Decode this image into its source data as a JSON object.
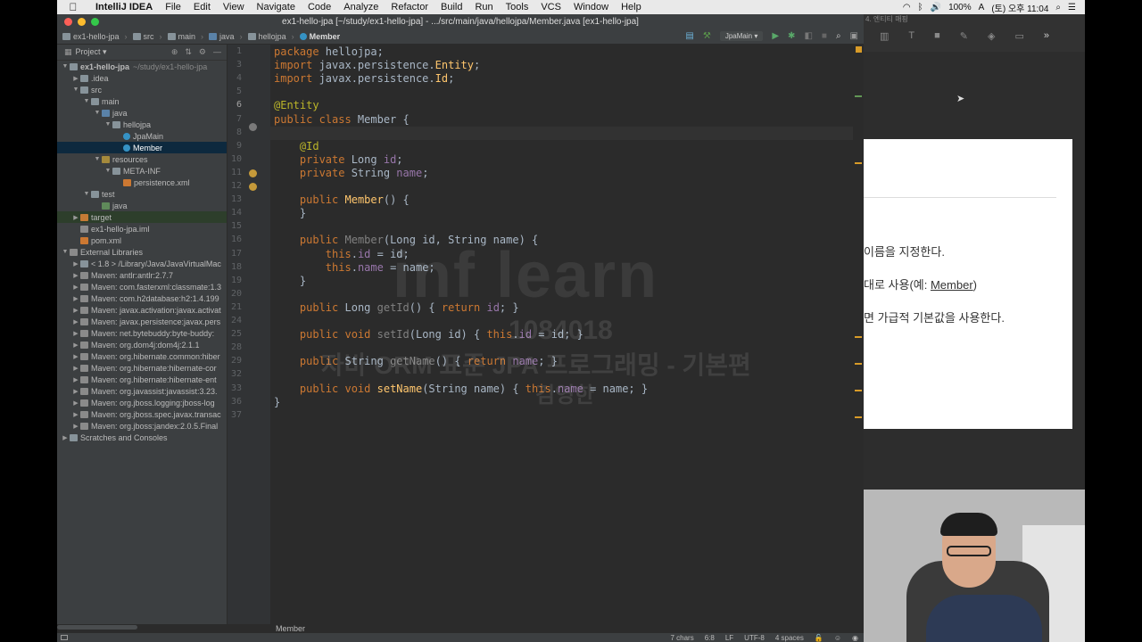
{
  "menubar": {
    "app_name": "IntelliJ IDEA",
    "items": [
      "File",
      "Edit",
      "View",
      "Navigate",
      "Code",
      "Analyze",
      "Refactor",
      "Build",
      "Run",
      "Tools",
      "VCS",
      "Window",
      "Help"
    ],
    "battery": "100%",
    "clock": "(토) 오후 11:04"
  },
  "window": {
    "title": "ex1-hello-jpa [~/study/ex1-hello-jpa] - .../src/main/java/hellojpa/Member.java [ex1-hello-jpa]"
  },
  "breadcrumbs": [
    "ex1-hello-jpa",
    "src",
    "main",
    "java",
    "hellojpa",
    "Member"
  ],
  "run_config": "JpaMain",
  "project_panel": {
    "title": "Project",
    "tree": [
      {
        "indent": 0,
        "arrow": "▼",
        "icon": "folder",
        "label": "ex1-hello-jpa",
        "hint": "~/study/ex1-hello-jpa",
        "bold": true
      },
      {
        "indent": 1,
        "arrow": "▶",
        "icon": "folder",
        "label": ".idea"
      },
      {
        "indent": 1,
        "arrow": "▼",
        "icon": "folder",
        "label": "src"
      },
      {
        "indent": 2,
        "arrow": "▼",
        "icon": "folder",
        "label": "main"
      },
      {
        "indent": 3,
        "arrow": "▼",
        "icon": "folder-src",
        "label": "java"
      },
      {
        "indent": 4,
        "arrow": "▼",
        "icon": "folder",
        "label": "hellojpa"
      },
      {
        "indent": 5,
        "arrow": "",
        "icon": "cls",
        "label": "JpaMain"
      },
      {
        "indent": 5,
        "arrow": "",
        "icon": "cls",
        "label": "Member",
        "selected": true
      },
      {
        "indent": 3,
        "arrow": "▼",
        "icon": "folder-res",
        "label": "resources"
      },
      {
        "indent": 4,
        "arrow": "▼",
        "icon": "folder",
        "label": "META-INF"
      },
      {
        "indent": 5,
        "arrow": "",
        "icon": "xml",
        "label": "persistence.xml"
      },
      {
        "indent": 2,
        "arrow": "▼",
        "icon": "folder",
        "label": "test"
      },
      {
        "indent": 3,
        "arrow": "",
        "icon": "folder-test",
        "label": "java"
      },
      {
        "indent": 1,
        "arrow": "▶",
        "icon": "folder-orange",
        "label": "target",
        "highlight": true
      },
      {
        "indent": 1,
        "arrow": "",
        "icon": "jar",
        "label": "ex1-hello-jpa.iml"
      },
      {
        "indent": 1,
        "arrow": "",
        "icon": "xml",
        "label": "pom.xml"
      },
      {
        "indent": 0,
        "arrow": "▼",
        "icon": "jar",
        "label": "External Libraries"
      },
      {
        "indent": 1,
        "arrow": "▶",
        "icon": "folder",
        "label": "< 1.8 > /Library/Java/JavaVirtualMac"
      },
      {
        "indent": 1,
        "arrow": "▶",
        "icon": "jar",
        "label": "Maven: antlr:antlr:2.7.7"
      },
      {
        "indent": 1,
        "arrow": "▶",
        "icon": "jar",
        "label": "Maven: com.fasterxml:classmate:1.3"
      },
      {
        "indent": 1,
        "arrow": "▶",
        "icon": "jar",
        "label": "Maven: com.h2database:h2:1.4.199"
      },
      {
        "indent": 1,
        "arrow": "▶",
        "icon": "jar",
        "label": "Maven: javax.activation:javax.activat"
      },
      {
        "indent": 1,
        "arrow": "▶",
        "icon": "jar",
        "label": "Maven: javax.persistence:javax.pers"
      },
      {
        "indent": 1,
        "arrow": "▶",
        "icon": "jar",
        "label": "Maven: net.bytebuddy:byte-buddy:"
      },
      {
        "indent": 1,
        "arrow": "▶",
        "icon": "jar",
        "label": "Maven: org.dom4j:dom4j:2.1.1"
      },
      {
        "indent": 1,
        "arrow": "▶",
        "icon": "jar",
        "label": "Maven: org.hibernate.common:hiber"
      },
      {
        "indent": 1,
        "arrow": "▶",
        "icon": "jar",
        "label": "Maven: org.hibernate:hibernate-cor"
      },
      {
        "indent": 1,
        "arrow": "▶",
        "icon": "jar",
        "label": "Maven: org.hibernate:hibernate-ent"
      },
      {
        "indent": 1,
        "arrow": "▶",
        "icon": "jar",
        "label": "Maven: org.javassist:javassist:3.23."
      },
      {
        "indent": 1,
        "arrow": "▶",
        "icon": "jar",
        "label": "Maven: org.jboss.logging:jboss-log"
      },
      {
        "indent": 1,
        "arrow": "▶",
        "icon": "jar",
        "label": "Maven: org.jboss.spec.javax.transac"
      },
      {
        "indent": 1,
        "arrow": "▶",
        "icon": "jar",
        "label": "Maven: org.jboss:jandex:2.0.5.Final"
      },
      {
        "indent": 0,
        "arrow": "▶",
        "icon": "folder",
        "label": "Scratches and Consoles"
      }
    ]
  },
  "editor": {
    "current_line": 6,
    "lines": [
      {
        "n": "1",
        "html": "<span class=\"kw\">package</span> hellojpa;"
      },
      {
        "n": "3",
        "html": "<span class=\"kw\">import</span> javax.persistence.<span class=\"fn\">Entity</span>;"
      },
      {
        "n": "4",
        "html": "<span class=\"kw\">import</span> javax.persistence.<span class=\"fn\">Id</span>;"
      },
      {
        "n": "5",
        "html": ""
      },
      {
        "n": "6",
        "html": "<span class=\"ann\">@Entity</span>"
      },
      {
        "n": "7",
        "html": "<span class=\"kw\">public class</span> Member {"
      },
      {
        "n": "8",
        "html": ""
      },
      {
        "n": "9",
        "html": "    <span class=\"ann\">@Id</span>"
      },
      {
        "n": "10",
        "html": "    <span class=\"kw\">private</span> Long <span class=\"fld\">id</span>;"
      },
      {
        "n": "11",
        "html": "    <span class=\"kw\">private</span> String <span class=\"fld\">name</span>;"
      },
      {
        "n": "12",
        "html": ""
      },
      {
        "n": "13",
        "html": "    <span class=\"kw\">public</span> <span class=\"fn\">Member</span>() {"
      },
      {
        "n": "14",
        "html": "    }"
      },
      {
        "n": "15",
        "html": ""
      },
      {
        "n": "16",
        "html": "    <span class=\"kw\">public</span> <span class=\"dim\">Member</span>(Long id, String name) {"
      },
      {
        "n": "17",
        "html": "        <span class=\"kw\">this</span>.<span class=\"fld\">id</span> = id;"
      },
      {
        "n": "18",
        "html": "        <span class=\"kw\">this</span>.<span class=\"fld\">name</span> = name;"
      },
      {
        "n": "19",
        "html": "    }"
      },
      {
        "n": "20",
        "html": ""
      },
      {
        "n": "21",
        "html": "    <span class=\"kw\">public</span> Long <span class=\"dim\">getId</span>() { <span class=\"kw\">return</span> <span class=\"fld\">id</span>; }"
      },
      {
        "n": "24",
        "html": ""
      },
      {
        "n": "25",
        "html": "    <span class=\"kw\">public void</span> <span class=\"dim\">setId</span>(Long id) { <span class=\"kw\">this</span>.<span class=\"fld\">id</span> = id; }"
      },
      {
        "n": "28",
        "html": ""
      },
      {
        "n": "29",
        "html": "    <span class=\"kw\">public</span> String <span class=\"dim\">getName</span>() { <span class=\"kw\">return</span> <span class=\"fld\">name</span>; }"
      },
      {
        "n": "32",
        "html": ""
      },
      {
        "n": "33",
        "html": "    <span class=\"kw\">public void</span> <span class=\"fn\">setName</span>(String name) { <span class=\"kw\">this</span>.<span class=\"fld\">name</span> = name; }"
      },
      {
        "n": "36",
        "html": "}"
      },
      {
        "n": "37",
        "html": ""
      }
    ],
    "footer_crumb": "Member"
  },
  "watermark": {
    "logo": "inf learn",
    "id": "1084018",
    "course": "자바 ORM 표준 JPA 프로그래밍 - 기본편",
    "name": "김영한"
  },
  "statusbar": {
    "selection": "7 chars",
    "position": "6:8",
    "line_sep": "LF",
    "encoding": "UTF-8",
    "indent": "4 spaces"
  },
  "slide_window": {
    "title": "4. 엔티티 매핑",
    "lines": [
      "이름을 지정한다.",
      "대로 사용(예: ",
      "Member",
      ")",
      "면 가급적 기본값을 사용한다."
    ]
  }
}
